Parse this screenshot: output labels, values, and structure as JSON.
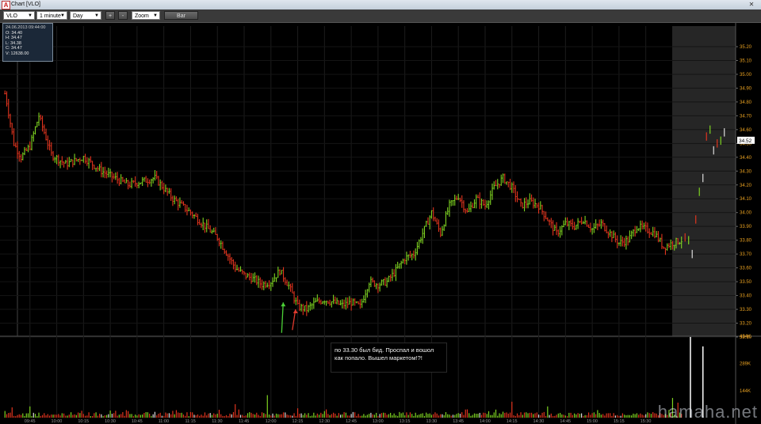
{
  "window": {
    "title": "Chart [VLO]",
    "app_icon": "app-logo-icon",
    "close_glyph": "✕"
  },
  "toolbar": {
    "symbol": "VLO",
    "interval": "1 minute",
    "period": "Day",
    "zoom_in": "+",
    "zoom_out": "-",
    "zoom": "Zoom",
    "chart_type": "Bar"
  },
  "info_box": {
    "datetime": "24.06.2013 09:44:00",
    "open": "O: 34.40",
    "high": "H: 34.47",
    "low": "L: 34.38",
    "close": "C: 34.47",
    "volume": "V: 12638.00"
  },
  "annotation": {
    "line1": "по 33.30 был бид. Проспал и вошол",
    "line2": "как попало. Вышел маркетом!?!"
  },
  "watermark": "hamaha.net",
  "colors": {
    "up": "#7ed321",
    "down": "#e0341e",
    "axis_text": "#e8a020",
    "last_price_bg": "#ffffff"
  },
  "chart_data": {
    "type": "bar",
    "title": "Chart [VLO]",
    "instrument": "VLO",
    "price_ticks": [
      "35.20",
      "35.10",
      "35.00",
      "34.90",
      "34.80",
      "34.70",
      "34.60",
      "34.50",
      "34.40",
      "34.30",
      "34.20",
      "34.10",
      "34.00",
      "33.90",
      "33.80",
      "33.70",
      "33.60",
      "33.50",
      "33.40",
      "33.30",
      "33.20",
      "33.10"
    ],
    "ylim": [
      33.1,
      35.24
    ],
    "last_price": "34.52",
    "volume_ticks": [
      "434K",
      "289K",
      "144K"
    ],
    "volume_ylim": [
      0,
      434
    ],
    "time_ticks": [
      "09:45",
      "10:00",
      "10:15",
      "10:30",
      "10:45",
      "11:00",
      "11:15",
      "11:30",
      "11:45",
      "12:00",
      "12:15",
      "12:30",
      "12:45",
      "13:00",
      "13:15",
      "13:30",
      "13:45",
      "14:00",
      "14:15",
      "14:30",
      "14:45",
      "15:00",
      "15:15",
      "15:30"
    ],
    "price_path": {
      "times": [
        570,
        572,
        576,
        580,
        585,
        590,
        597,
        605,
        615,
        625,
        640,
        655,
        665,
        675,
        690,
        700,
        705,
        710,
        715,
        720,
        725,
        730,
        735,
        740,
        745,
        750,
        755,
        760,
        765,
        770,
        775,
        780,
        785,
        790,
        795,
        800,
        805,
        810,
        815,
        820,
        825,
        830,
        835,
        840,
        845,
        850,
        855,
        860,
        865,
        870,
        875,
        880,
        885,
        890,
        895,
        900,
        905,
        910,
        915,
        920,
        925,
        930,
        935,
        940,
        945,
        950
      ],
      "prices": [
        34.92,
        34.8,
        34.5,
        34.4,
        34.48,
        34.7,
        34.42,
        34.35,
        34.4,
        34.3,
        34.2,
        34.25,
        34.1,
        34.0,
        33.82,
        33.6,
        33.55,
        33.52,
        33.48,
        33.5,
        33.58,
        33.47,
        33.32,
        33.3,
        33.35,
        33.37,
        33.35,
        33.33,
        33.35,
        33.32,
        33.5,
        33.48,
        33.5,
        33.58,
        33.67,
        33.7,
        33.85,
        34.0,
        33.85,
        34.05,
        34.12,
        34.0,
        34.1,
        34.05,
        34.18,
        34.25,
        34.18,
        34.05,
        34.08,
        34.05,
        33.95,
        33.85,
        33.92,
        33.9,
        33.95,
        33.88,
        33.92,
        33.85,
        33.78,
        33.8,
        33.9,
        33.88,
        33.85,
        33.75,
        33.78,
        33.8
      ],
      "session_end_time": 950
    },
    "after_hours": [
      {
        "t": 952,
        "p": 33.82
      },
      {
        "t": 954,
        "p": 33.8
      },
      {
        "t": 956,
        "p": 33.7
      },
      {
        "t": 958,
        "p": 33.95
      },
      {
        "t": 960,
        "p": 34.15
      },
      {
        "t": 962,
        "p": 34.25
      },
      {
        "t": 964,
        "p": 34.55
      },
      {
        "t": 966,
        "p": 34.6
      },
      {
        "t": 968,
        "p": 34.45
      },
      {
        "t": 970,
        "p": 34.5
      },
      {
        "t": 972,
        "p": 34.52
      },
      {
        "t": 974,
        "p": 34.58
      }
    ],
    "volume": {
      "typical_k": [
        8,
        45
      ],
      "spikes": [
        {
          "t": 575,
          "v": 55
        },
        {
          "t": 585,
          "v": 60
        },
        {
          "t": 630,
          "v": 38
        },
        {
          "t": 700,
          "v": 72
        },
        {
          "t": 718,
          "v": 120
        },
        {
          "t": 735,
          "v": 50
        },
        {
          "t": 750,
          "v": 35
        },
        {
          "t": 855,
          "v": 85
        },
        {
          "t": 875,
          "v": 60
        },
        {
          "t": 945,
          "v": 105
        },
        {
          "t": 948,
          "v": 80
        }
      ],
      "after_hours": [
        {
          "t": 955,
          "v": 430
        },
        {
          "t": 962,
          "v": 380
        }
      ]
    },
    "arrows": [
      {
        "t": 726,
        "from": 33.13,
        "to": 33.35,
        "color": "green"
      },
      {
        "t": 732,
        "from": 33.15,
        "to": 33.3,
        "color": "red"
      }
    ],
    "grid": true
  }
}
